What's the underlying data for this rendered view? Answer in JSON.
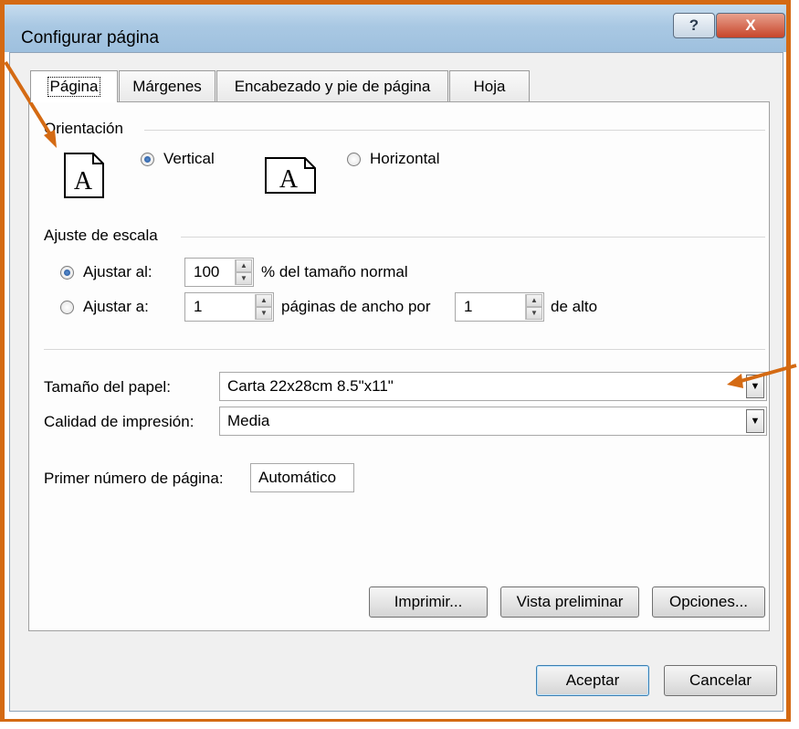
{
  "window": {
    "title": "Configurar página",
    "help_label": "?",
    "close_label": "X"
  },
  "tabs": [
    {
      "label": "Página",
      "active": true
    },
    {
      "label": "Márgenes",
      "active": false
    },
    {
      "label": "Encabezado y pie de página",
      "active": false
    },
    {
      "label": "Hoja",
      "active": false
    }
  ],
  "orientation": {
    "group_label": "Orientación",
    "vertical_label": "Vertical",
    "vertical_selected": true,
    "horizontal_label": "Horizontal",
    "horizontal_selected": false,
    "icon_letter": "A"
  },
  "scaling": {
    "group_label": "Ajuste de escala",
    "adjust_to_label": "Ajustar al:",
    "adjust_to_selected": true,
    "adjust_to_value": "100",
    "adjust_to_suffix": "% del tamaño normal",
    "fit_to_label": "Ajustar a:",
    "fit_to_selected": false,
    "fit_wide_value": "1",
    "fit_wide_suffix": "páginas de ancho por",
    "fit_tall_value": "1",
    "fit_tall_suffix": "de alto"
  },
  "paper": {
    "size_label": "Tamaño del papel:",
    "size_value": "Carta 22x28cm 8.5\"x11\"",
    "quality_label": "Calidad de impresión:",
    "quality_value": "Media",
    "first_page_label": "Primer número de página:",
    "first_page_value": "Automático"
  },
  "buttons": {
    "print": "Imprimir...",
    "preview": "Vista preliminar",
    "options": "Opciones...",
    "ok": "Aceptar",
    "cancel": "Cancelar"
  },
  "colors": {
    "annotation": "#d46a13",
    "titlebar": "#a9c8e3",
    "close": "#c7452a"
  }
}
